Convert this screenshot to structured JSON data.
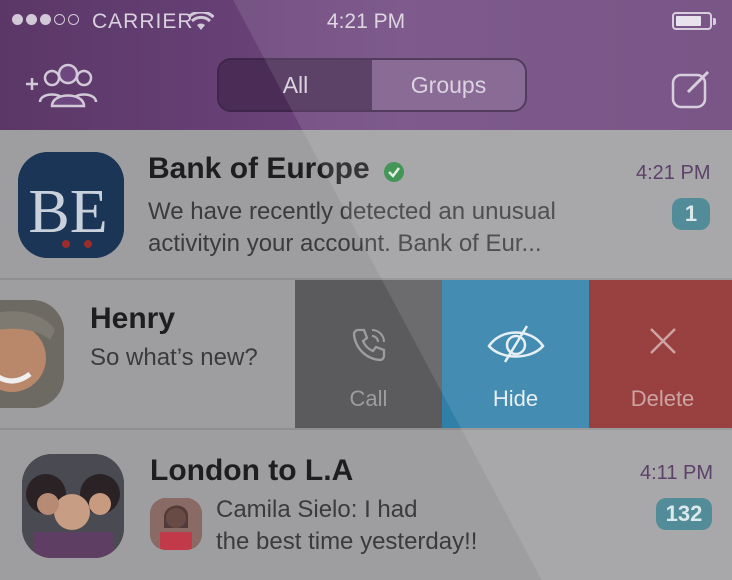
{
  "status_bar": {
    "carrier": "CARRIER",
    "time": "4:21 PM",
    "signal_bars_filled": 3,
    "signal_bars_total": 5
  },
  "header": {
    "tabs": [
      {
        "label": "All",
        "selected": true
      },
      {
        "label": "Groups",
        "selected": false
      }
    ],
    "icons": {
      "left": "add-group-icon",
      "right": "compose-icon"
    },
    "colors": {
      "header_bg": "#6a4379",
      "accent": "#4a2b58"
    }
  },
  "chats": [
    {
      "name": "Bank of Europe",
      "verified": true,
      "preview": "We have recently detected an unusual activityin your account. Bank of Eur...",
      "preview_line1": "We have recently detected an unusual",
      "preview_line2": "activityin your account. Bank of Eur...",
      "time": "4:21 PM",
      "unread": "1",
      "avatar_text": "B.E."
    },
    {
      "name": "Henry",
      "preview": "So what’s new?",
      "swipe_actions": [
        {
          "label": "Call",
          "icon": "phone-icon",
          "color": "#5b5b5d"
        },
        {
          "label": "Hide",
          "icon": "eye-hidden-icon",
          "color": "#2f7fa8"
        },
        {
          "label": "Delete",
          "icon": "close-icon",
          "color": "#8d2a2a"
        }
      ]
    },
    {
      "name": "London to L.A",
      "sender": "Camila Sielo:",
      "preview_line1": "I had",
      "preview_line2": "the best time yesterday!!",
      "time": "4:11 PM",
      "unread": "132"
    }
  ]
}
